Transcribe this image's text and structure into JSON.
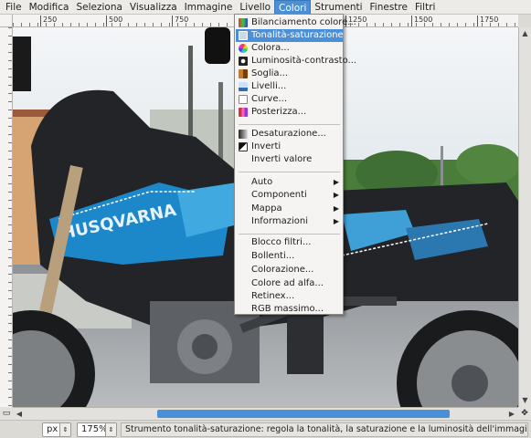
{
  "menubar": {
    "items": [
      "File",
      "Modifica",
      "Seleziona",
      "Visualizza",
      "Immagine",
      "Livello",
      "Colori",
      "Strumenti",
      "Finestre",
      "Filtri"
    ],
    "active_index": 6
  },
  "ruler": {
    "top_labels": [
      "250",
      "500",
      "750",
      "1000",
      "1250",
      "1500",
      "1750"
    ]
  },
  "colors_menu": {
    "items": [
      {
        "label": "Bilanciamento colore...",
        "icon": "color-balance-icon",
        "highlight": false
      },
      {
        "label": "Tonalità-saturazione",
        "icon": "hue-saturation-icon",
        "highlight": true
      },
      {
        "label": "Colora...",
        "icon": "colorize-icon",
        "highlight": false
      },
      {
        "label": "Luminosità-contrasto...",
        "icon": "brightness-contrast-icon",
        "highlight": false
      },
      {
        "label": "Soglia...",
        "icon": "threshold-icon",
        "highlight": false
      },
      {
        "label": "Livelli...",
        "icon": "levels-icon",
        "highlight": false
      },
      {
        "label": "Curve...",
        "icon": "curves-icon",
        "highlight": false
      },
      {
        "label": "Posterizza...",
        "icon": "posterize-icon",
        "highlight": false
      }
    ],
    "group2": [
      {
        "label": "Desaturazione...",
        "icon": "desaturate-icon"
      },
      {
        "label": "Inverti",
        "icon": "invert-icon"
      },
      {
        "label": "Inverti valore",
        "icon": ""
      }
    ],
    "group3": [
      {
        "label": "Auto",
        "submenu": true
      },
      {
        "label": "Componenti",
        "submenu": true
      },
      {
        "label": "Mappa",
        "submenu": true
      },
      {
        "label": "Informazioni",
        "submenu": true
      }
    ],
    "group4": [
      {
        "label": "Blocco filtri..."
      },
      {
        "label": "Bollenti..."
      },
      {
        "label": "Colorazione..."
      },
      {
        "label": "Colore ad alfa..."
      },
      {
        "label": "Retinex..."
      },
      {
        "label": "RGB massimo..."
      }
    ]
  },
  "statusbar": {
    "unit": "px",
    "zoom": "175%",
    "message": "Strumento tonalità-saturazione: regola la tonalità, la saturazione e la luminosità dell'immagine"
  },
  "colors": {
    "accent": "#4a90d9"
  }
}
